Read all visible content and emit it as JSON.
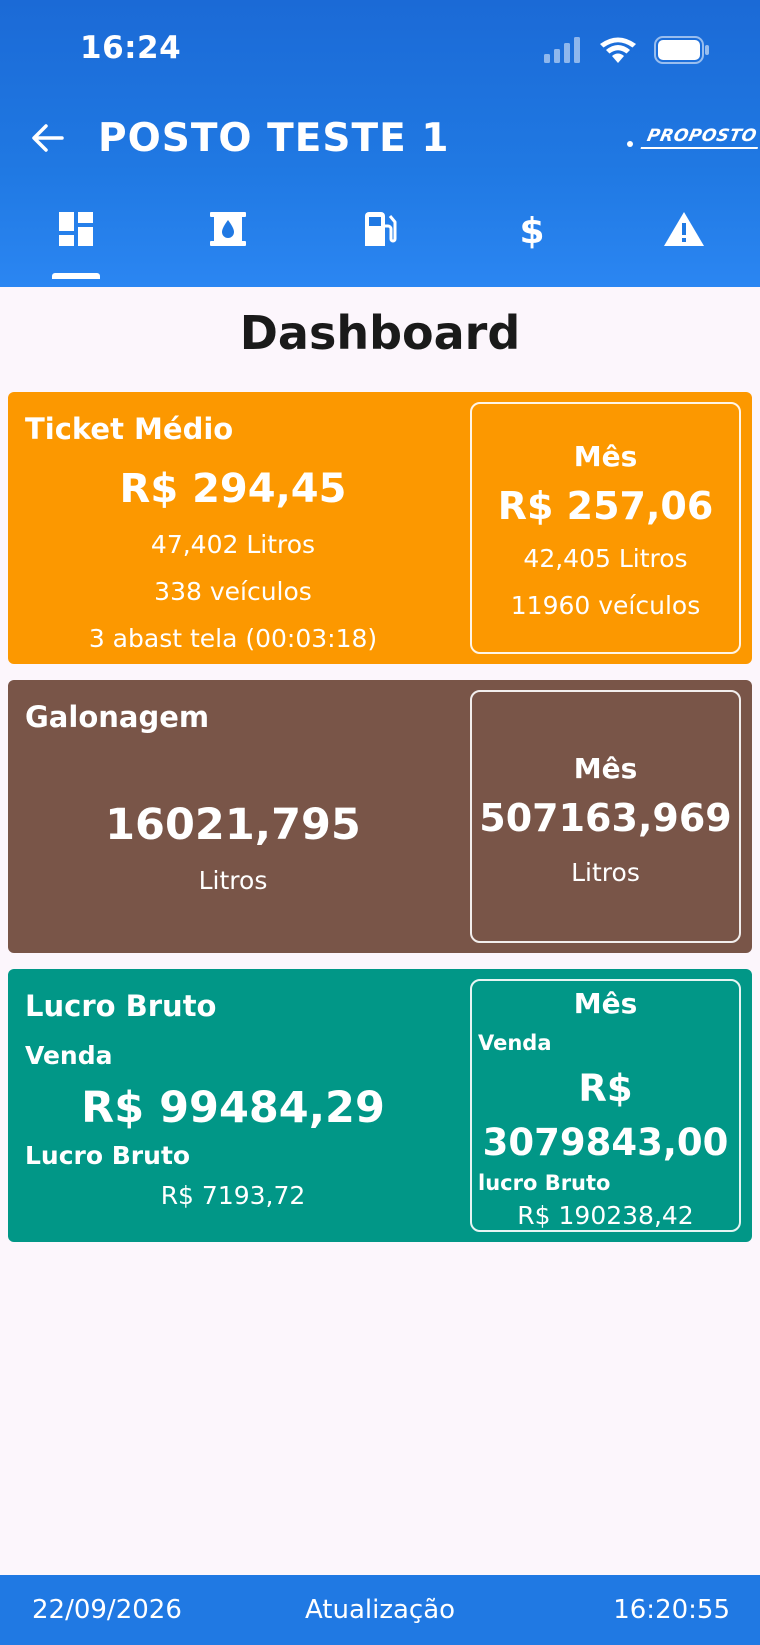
{
  "status_bar": {
    "time": "16:24"
  },
  "app_bar": {
    "title": "POSTO TESTE 1",
    "logo_text": "PROPOSTO"
  },
  "tabs": [
    {
      "icon": "dashboard-icon",
      "selected": true
    },
    {
      "icon": "oil-barrel-icon",
      "selected": false
    },
    {
      "icon": "fuel-pump-icon",
      "selected": false
    },
    {
      "icon": "dollar-icon",
      "selected": false
    },
    {
      "icon": "warning-icon",
      "selected": false
    }
  ],
  "page_title": "Dashboard",
  "ticket_card": {
    "title": "Ticket Médio",
    "value": "R$ 294,45",
    "litros": "47,402 Litros",
    "veiculos": "338 veículos",
    "abast": "3 abast tela (00:03:18)",
    "month": {
      "label": "Mês",
      "value": "R$ 257,06",
      "litros": "42,405 Litros",
      "veiculos": "11960 veículos"
    },
    "color": "#fc9800"
  },
  "galonagem_card": {
    "title": "Galonagem",
    "value": "16021,795",
    "unit": "Litros",
    "month": {
      "label": "Mês",
      "value": "507163,969",
      "unit": "Litros"
    },
    "color": "#795548"
  },
  "lucro_card": {
    "title": "Lucro Bruto",
    "venda_label": "Venda",
    "venda_value": "R$ 99484,29",
    "lucro_label": "Lucro Bruto",
    "lucro_value": "R$ 7193,72",
    "month": {
      "label": "Mês",
      "venda_label": "Venda",
      "venda_currency": "R$",
      "venda_value": "3079843,00",
      "lucro_label": "lucro Bruto",
      "lucro_value": "R$ 190238,42"
    },
    "color": "#019787"
  },
  "footer": {
    "date": "22/09/2026",
    "label": "Atualização",
    "time": "16:20:55",
    "color": "#2079e3"
  }
}
